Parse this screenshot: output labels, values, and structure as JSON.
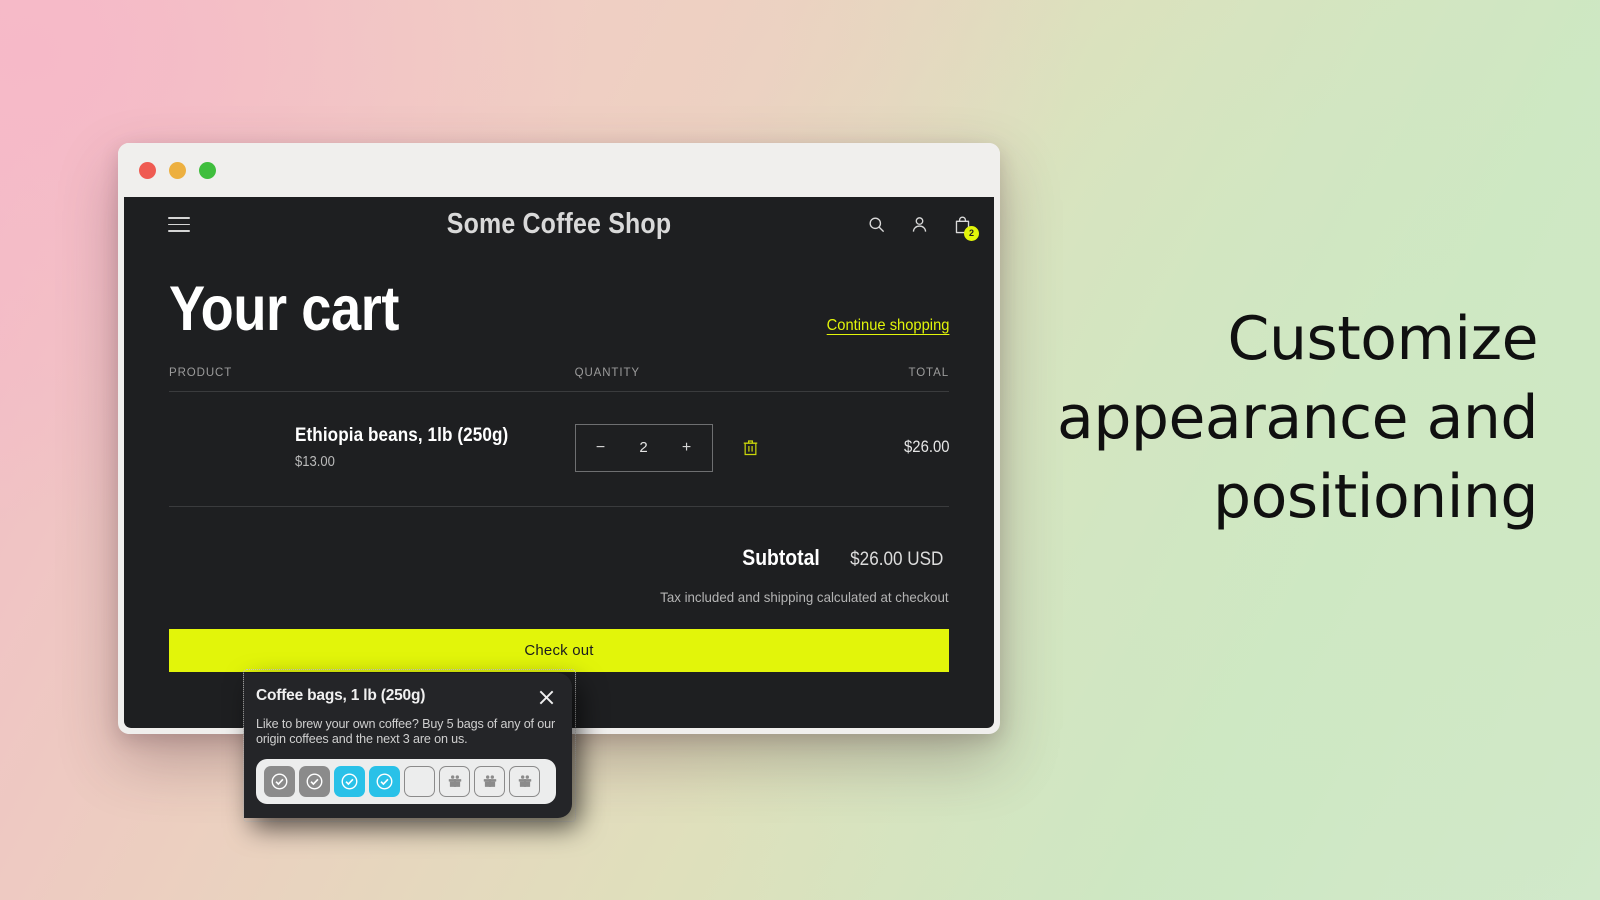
{
  "background": {
    "gradient_from": "#f4b9c8",
    "gradient_to": "#cde7c3"
  },
  "window": {
    "traffic_lights": [
      {
        "name": "close",
        "color": "#ef5b52"
      },
      {
        "name": "minimize",
        "color": "#edb040"
      },
      {
        "name": "maximize",
        "color": "#3fbe3d"
      }
    ]
  },
  "site_header": {
    "menu_icon": "hamburger-icon",
    "shop_title": "Some Coffee Shop",
    "icons": [
      {
        "name": "search-icon"
      },
      {
        "name": "account-icon"
      },
      {
        "name": "cart-icon"
      }
    ],
    "cart_count": "2"
  },
  "cart": {
    "title": "Your cart",
    "continue_shopping": "Continue shopping",
    "columns": {
      "product": "PRODUCT",
      "quantity": "QUANTITY",
      "total": "TOTAL"
    },
    "items": [
      {
        "name": "Ethiopia beans, 1lb (250g)",
        "price": "$13.00",
        "quantity": "2",
        "decrease_label": "−",
        "increase_label": "+",
        "remove_icon": "trash-icon",
        "total": "$26.00"
      }
    ]
  },
  "summary": {
    "subtotal_label": "Subtotal",
    "subtotal_value": "$26.00 USD",
    "tax_note": "Tax included and shipping calculated at checkout",
    "checkout_label": "Check out",
    "checkout_color": "#e2f50a"
  },
  "popup": {
    "title": "Coffee bags, 1 lb (250g)",
    "close_icon": "close-icon",
    "description": "Like to brew your own coffee? Buy 5 bags of any of our origin coffees and the next 3 are on us.",
    "progress": {
      "cells": [
        {
          "state": "done",
          "icon": "check-circle-icon",
          "color": "#8b8b8b"
        },
        {
          "state": "done",
          "icon": "check-circle-icon",
          "color": "#8b8b8b"
        },
        {
          "state": "active",
          "icon": "check-circle-icon",
          "color": "#29c1e8"
        },
        {
          "state": "active",
          "icon": "check-circle-icon",
          "color": "#29c1e8"
        },
        {
          "state": "empty",
          "icon": "",
          "color": "#eceded"
        },
        {
          "state": "gift",
          "icon": "gift-icon",
          "color": "#8b8b8b"
        },
        {
          "state": "gift",
          "icon": "gift-icon",
          "color": "#8b8b8b"
        },
        {
          "state": "gift",
          "icon": "gift-icon",
          "color": "#8b8b8b"
        }
      ]
    }
  },
  "caption": {
    "text": "Customize appearance and positioning"
  }
}
